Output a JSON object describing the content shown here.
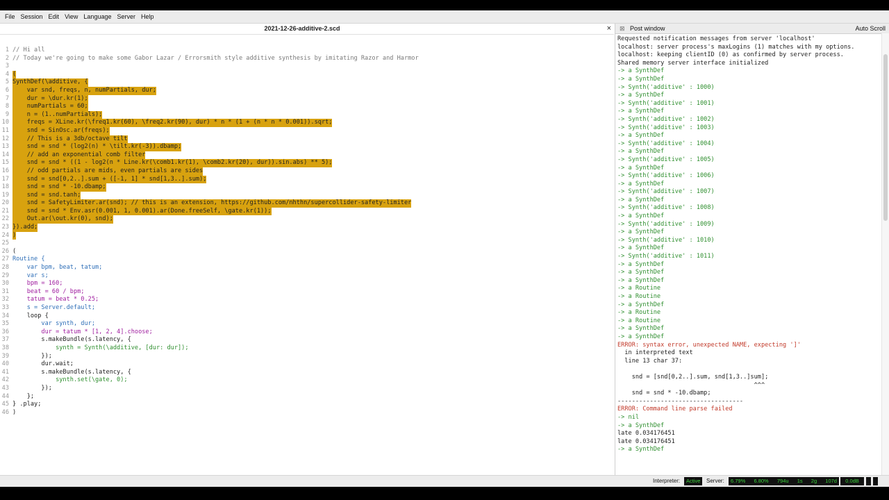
{
  "menu": [
    "File",
    "Session",
    "Edit",
    "View",
    "Language",
    "Server",
    "Help"
  ],
  "editor": {
    "title": "2021-12-26-additive-2.scd",
    "close_glyph": "×",
    "lines": [
      {
        "n": "1",
        "t": "// Hi all",
        "k": "c"
      },
      {
        "n": "2",
        "t": "// Today we're going to make some Gabor Lazar / Errorsmith style additive synthesis by imitating Razor and Harmor",
        "k": "c"
      },
      {
        "n": "3",
        "t": "",
        "k": ""
      },
      {
        "n": "4",
        "t": "(",
        "k": "h"
      },
      {
        "n": "5",
        "t": "SynthDef(\\additive, {",
        "k": "h"
      },
      {
        "n": "6",
        "t": "    var snd, freqs, n, numPartials, dur;",
        "k": "h"
      },
      {
        "n": "7",
        "t": "    dur = \\dur.kr(1);",
        "k": "h"
      },
      {
        "n": "8",
        "t": "    numPartials = 60;",
        "k": "h"
      },
      {
        "n": "9",
        "t": "    n = (1..numPartials);",
        "k": "h"
      },
      {
        "n": "10",
        "t": "    freqs = XLine.kr(\\freq1.kr(60), \\freq2.kr(90), dur) * n * (1 + (n * n * 0.001)).sqrt;",
        "k": "h"
      },
      {
        "n": "11",
        "t": "    snd = SinOsc.ar(freqs);",
        "k": "h"
      },
      {
        "n": "12",
        "t": "    // This is a 3db/octave tilt",
        "k": "h"
      },
      {
        "n": "13",
        "t": "    snd = snd * (log2(n) * \\tilt.kr(-3)).dbamp;",
        "k": "h"
      },
      {
        "n": "14",
        "t": "    // add an exponential comb filter",
        "k": "h"
      },
      {
        "n": "15",
        "t": "    snd = snd * ((1 - log2(n * Line.kr(\\comb1.kr(1), \\comb2.kr(20), dur)).sin.abs) ** 5);",
        "k": "h"
      },
      {
        "n": "16",
        "t": "    // odd partials are mids, even partials are sides",
        "k": "h"
      },
      {
        "n": "17",
        "t": "    snd = snd[0,2..].sum + ([-1, 1] * snd[1,3..].sum);",
        "k": "h"
      },
      {
        "n": "18",
        "t": "    snd = snd * -10.dbamp;",
        "k": "h"
      },
      {
        "n": "19",
        "t": "    snd = snd.tanh;",
        "k": "h"
      },
      {
        "n": "20",
        "t": "    snd = SafetyLimiter.ar(snd); // this is an extension, https://github.com/nhthn/supercollider-safety-limiter",
        "k": "h"
      },
      {
        "n": "21",
        "t": "    snd = snd * Env.asr(0.001, 1, 0.001).ar(Done.freeSelf, \\gate.kr(1));",
        "k": "h"
      },
      {
        "n": "22",
        "t": "    Out.ar(\\out.kr(0), snd);",
        "k": "h"
      },
      {
        "n": "23",
        "t": "}).add;",
        "k": "h"
      },
      {
        "n": "24",
        "t": ")",
        "k": "h"
      },
      {
        "n": "25",
        "t": "",
        "k": ""
      },
      {
        "n": "26",
        "t": "(",
        "k": ""
      },
      {
        "n": "27",
        "t": "Routine {",
        "k": "r"
      },
      {
        "n": "28",
        "t": "    var bpm, beat, tatum;",
        "k": "v"
      },
      {
        "n": "29",
        "t": "    var s;",
        "k": "v"
      },
      {
        "n": "30",
        "t": "    bpm = 160;",
        "k": "n"
      },
      {
        "n": "31",
        "t": "    beat = 60 / bpm;",
        "k": "n"
      },
      {
        "n": "32",
        "t": "    tatum = beat * 0.25;",
        "k": "n"
      },
      {
        "n": "33",
        "t": "    s = Server.default;",
        "k": "s"
      },
      {
        "n": "34",
        "t": "    loop {",
        "k": ""
      },
      {
        "n": "35",
        "t": "        var synth, dur;",
        "k": "v"
      },
      {
        "n": "36",
        "t": "        dur = tatum * [1, 2, 4].choose;",
        "k": "n"
      },
      {
        "n": "37",
        "t": "        s.makeBundle(s.latency, {",
        "k": ""
      },
      {
        "n": "38",
        "t": "            synth = Synth(\\additive, [dur: dur]);",
        "k": "y"
      },
      {
        "n": "39",
        "t": "        });",
        "k": ""
      },
      {
        "n": "40",
        "t": "        dur.wait;",
        "k": ""
      },
      {
        "n": "41",
        "t": "        s.makeBundle(s.latency, {",
        "k": ""
      },
      {
        "n": "42",
        "t": "            synth.set(\\gate, 0);",
        "k": "g"
      },
      {
        "n": "43",
        "t": "        });",
        "k": ""
      },
      {
        "n": "44",
        "t": "    };",
        "k": ""
      },
      {
        "n": "45",
        "t": "} .play;",
        "k": ""
      },
      {
        "n": "46",
        "t": ")",
        "k": ""
      }
    ]
  },
  "post": {
    "close_glyph": "⊠",
    "title": "Post window",
    "auto_scroll": "Auto Scroll",
    "lines": [
      {
        "t": "Requested notification messages from server 'localhost'",
        "k": ""
      },
      {
        "t": "localhost: server process's maxLogins (1) matches with my options.",
        "k": ""
      },
      {
        "t": "localhost: keeping clientID (0) as confirmed by server process.",
        "k": ""
      },
      {
        "t": "Shared memory server interface initialized",
        "k": ""
      },
      {
        "t": "-> a SynthDef",
        "k": "i"
      },
      {
        "t": "-> a SynthDef",
        "k": "i"
      },
      {
        "t": "-> Synth('additive' : 1000)",
        "k": "i"
      },
      {
        "t": "-> a SynthDef",
        "k": "i"
      },
      {
        "t": "-> Synth('additive' : 1001)",
        "k": "i"
      },
      {
        "t": "-> a SynthDef",
        "k": "i"
      },
      {
        "t": "-> Synth('additive' : 1002)",
        "k": "i"
      },
      {
        "t": "-> Synth('additive' : 1003)",
        "k": "i"
      },
      {
        "t": "-> a SynthDef",
        "k": "i"
      },
      {
        "t": "-> Synth('additive' : 1004)",
        "k": "i"
      },
      {
        "t": "-> a SynthDef",
        "k": "i"
      },
      {
        "t": "-> Synth('additive' : 1005)",
        "k": "i"
      },
      {
        "t": "-> a SynthDef",
        "k": "i"
      },
      {
        "t": "-> Synth('additive' : 1006)",
        "k": "i"
      },
      {
        "t": "-> a SynthDef",
        "k": "i"
      },
      {
        "t": "-> Synth('additive' : 1007)",
        "k": "i"
      },
      {
        "t": "-> a SynthDef",
        "k": "i"
      },
      {
        "t": "-> Synth('additive' : 1008)",
        "k": "i"
      },
      {
        "t": "-> a SynthDef",
        "k": "i"
      },
      {
        "t": "-> Synth('additive' : 1009)",
        "k": "i"
      },
      {
        "t": "-> a SynthDef",
        "k": "i"
      },
      {
        "t": "-> Synth('additive' : 1010)",
        "k": "i"
      },
      {
        "t": "-> a SynthDef",
        "k": "i"
      },
      {
        "t": "-> Synth('additive' : 1011)",
        "k": "i"
      },
      {
        "t": "-> a SynthDef",
        "k": "i"
      },
      {
        "t": "-> a SynthDef",
        "k": "i"
      },
      {
        "t": "-> a SynthDef",
        "k": "i"
      },
      {
        "t": "-> a Routine",
        "k": "i"
      },
      {
        "t": "-> a Routine",
        "k": "i"
      },
      {
        "t": "-> a SynthDef",
        "k": "i"
      },
      {
        "t": "-> a Routine",
        "k": "i"
      },
      {
        "t": "-> a Routine",
        "k": "i"
      },
      {
        "t": "-> a SynthDef",
        "k": "i"
      },
      {
        "t": "-> a SynthDef",
        "k": "i"
      },
      {
        "t": "ERROR: syntax error, unexpected NAME, expecting ']'",
        "k": "e"
      },
      {
        "t": "  in interpreted text",
        "k": ""
      },
      {
        "t": "  line 13 char 37:",
        "k": ""
      },
      {
        "t": "",
        "k": ""
      },
      {
        "t": "    snd = [snd[0,2..].sum, snd[1,3..]sum];",
        "k": ""
      },
      {
        "t": "                                      ^^^",
        "k": ""
      },
      {
        "t": "    snd = snd * -10.dbamp;",
        "k": ""
      },
      {
        "t": "-----------------------------------",
        "k": ""
      },
      {
        "t": "ERROR: Command line parse failed",
        "k": "e"
      },
      {
        "t": "-> nil",
        "k": "i"
      },
      {
        "t": "-> a SynthDef",
        "k": "i"
      },
      {
        "t": "late 0.034176451",
        "k": ""
      },
      {
        "t": "late 0.034176451",
        "k": ""
      },
      {
        "t": "-> a SynthDef",
        "k": "i"
      }
    ]
  },
  "status": {
    "interpreter_label": "Interpreter:",
    "interpreter_state": "Active",
    "server_label": "Server:",
    "server_stats": [
      "6.79%",
      "6.80%",
      "794u",
      "1s",
      "2g",
      "107d"
    ],
    "volume": "0.0dB"
  },
  "colors": {
    "selection": "#d8a20f",
    "info": "#2f8f2f",
    "error": "#c23a2a",
    "status_green": "#3cd13c"
  }
}
